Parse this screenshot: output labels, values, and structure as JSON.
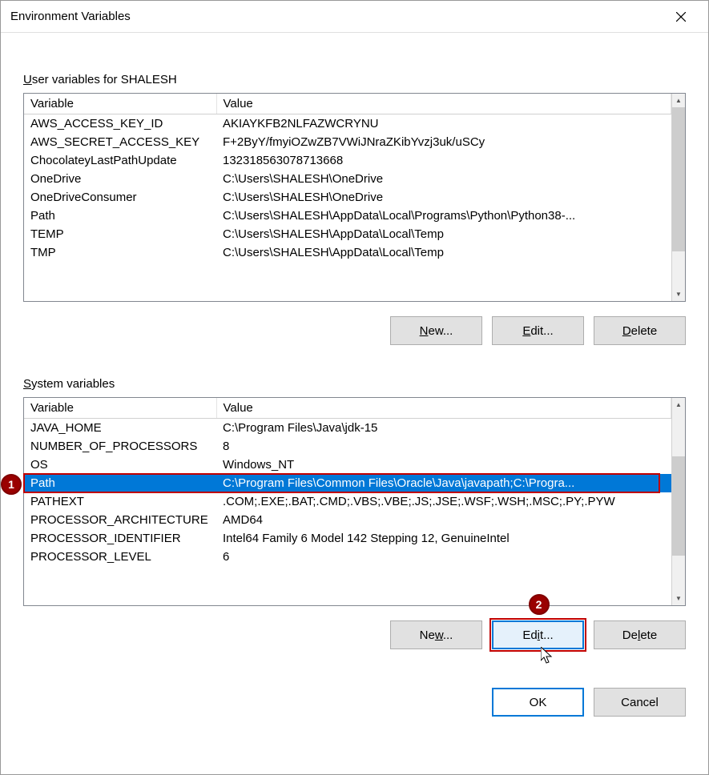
{
  "dialog": {
    "title": "Environment Variables"
  },
  "userSection": {
    "label_prefix": "U",
    "label_rest": "ser variables for SHALESH",
    "columns": {
      "variable": "Variable",
      "value": "Value"
    },
    "rows": [
      {
        "variable": "AWS_ACCESS_KEY_ID",
        "value": "AKIAYKFB2NLFAZWCRYNU"
      },
      {
        "variable": "AWS_SECRET_ACCESS_KEY",
        "value": "F+2ByY/fmyiOZwZB7VWiJNraZKibYvzj3uk/uSCy"
      },
      {
        "variable": "ChocolateyLastPathUpdate",
        "value": "132318563078713668"
      },
      {
        "variable": "OneDrive",
        "value": "C:\\Users\\SHALESH\\OneDrive"
      },
      {
        "variable": "OneDriveConsumer",
        "value": "C:\\Users\\SHALESH\\OneDrive"
      },
      {
        "variable": "Path",
        "value": "C:\\Users\\SHALESH\\AppData\\Local\\Programs\\Python\\Python38-..."
      },
      {
        "variable": "TEMP",
        "value": "C:\\Users\\SHALESH\\AppData\\Local\\Temp"
      },
      {
        "variable": "TMP",
        "value": "C:\\Users\\SHALESH\\AppData\\Local\\Temp"
      }
    ],
    "buttons": {
      "new_u": "N",
      "new_rest": "ew...",
      "edit_u": "E",
      "edit_rest": "dit...",
      "delete_u": "D",
      "delete_rest": "elete"
    }
  },
  "systemSection": {
    "label_prefix": "S",
    "label_rest": "ystem variables",
    "columns": {
      "variable": "Variable",
      "value": "Value"
    },
    "rows": [
      {
        "variable": "JAVA_HOME",
        "value": "C:\\Program Files\\Java\\jdk-15"
      },
      {
        "variable": "NUMBER_OF_PROCESSORS",
        "value": "8"
      },
      {
        "variable": "OS",
        "value": "Windows_NT"
      },
      {
        "variable": "Path",
        "value": "C:\\Program Files\\Common Files\\Oracle\\Java\\javapath;C:\\Progra..."
      },
      {
        "variable": "PATHEXT",
        "value": ".COM;.EXE;.BAT;.CMD;.VBS;.VBE;.JS;.JSE;.WSF;.WSH;.MSC;.PY;.PYW"
      },
      {
        "variable": "PROCESSOR_ARCHITECTURE",
        "value": "AMD64"
      },
      {
        "variable": "PROCESSOR_IDENTIFIER",
        "value": "Intel64 Family 6 Model 142 Stepping 12, GenuineIntel"
      },
      {
        "variable": "PROCESSOR_LEVEL",
        "value": "6"
      }
    ],
    "selectedIndex": 3,
    "buttons": {
      "new_u": "w",
      "new_pre": "Ne",
      "new_post": "...",
      "edit_u": "i",
      "edit_pre": "Ed",
      "edit_post": "t...",
      "delete_u": "l",
      "delete_pre": "De",
      "delete_post": "ete"
    }
  },
  "bottom": {
    "ok": "OK",
    "cancel": "Cancel"
  },
  "callouts": {
    "c1": "1",
    "c2": "2"
  }
}
